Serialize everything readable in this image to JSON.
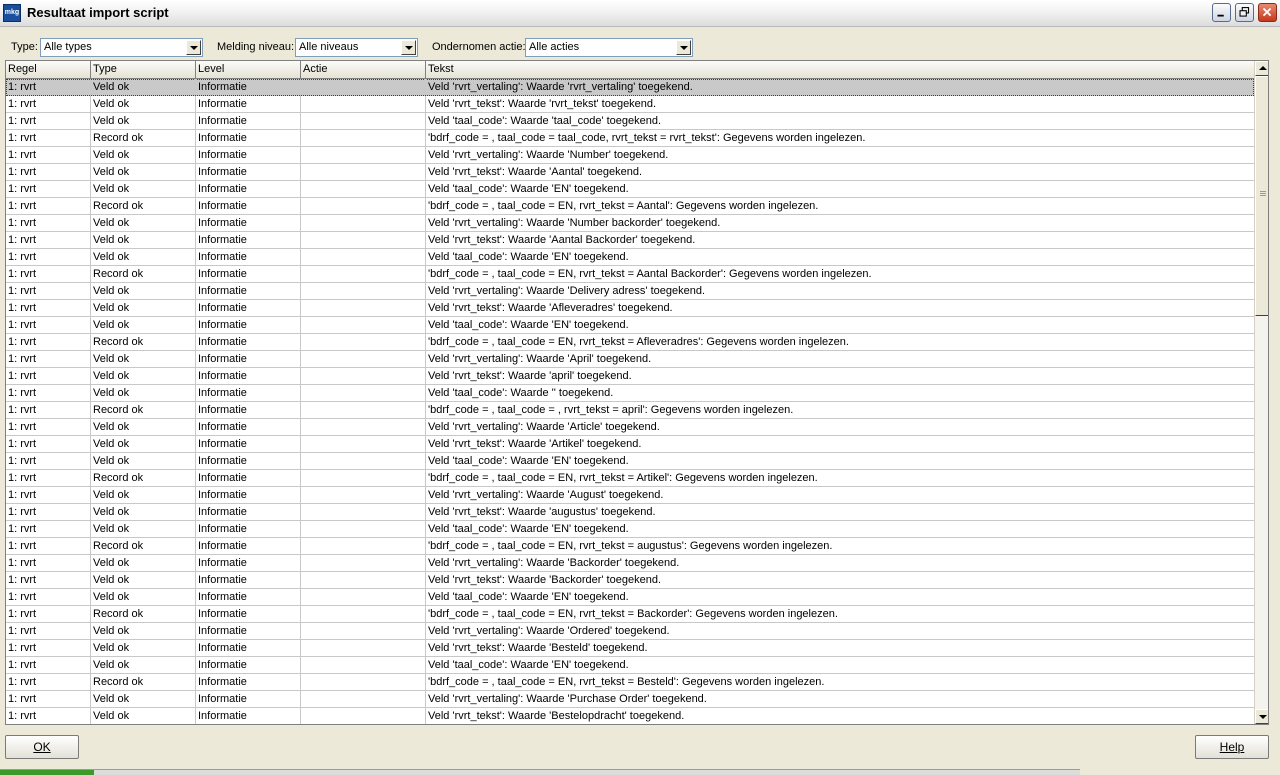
{
  "window": {
    "title": "Resultaat import script",
    "app_icon_text": "mkg"
  },
  "filters": {
    "type_label": "Type:",
    "type_value": "Alle types",
    "melding_label": "Melding niveau:",
    "melding_value": "Alle niveaus",
    "actie_label": "Ondernomen actie:",
    "actie_value": "Alle acties"
  },
  "grid": {
    "columns": [
      "Regel",
      "Type",
      "Level",
      "Actie",
      "Tekst"
    ],
    "rows": [
      {
        "regel": "1: rvrt",
        "type": "Veld ok",
        "level": "Informatie",
        "actie": "",
        "tekst": "Veld 'rvrt_vertaling': Waarde 'rvrt_vertaling' toegekend."
      },
      {
        "regel": "1: rvrt",
        "type": "Veld ok",
        "level": "Informatie",
        "actie": "",
        "tekst": "Veld 'rvrt_tekst': Waarde 'rvrt_tekst' toegekend."
      },
      {
        "regel": "1: rvrt",
        "type": "Veld ok",
        "level": "Informatie",
        "actie": "",
        "tekst": "Veld 'taal_code': Waarde 'taal_code' toegekend."
      },
      {
        "regel": "1: rvrt",
        "type": "Record ok",
        "level": "Informatie",
        "actie": "",
        "tekst": "'bdrf_code = , taal_code = taal_code, rvrt_tekst = rvrt_tekst': Gegevens worden ingelezen."
      },
      {
        "regel": "1: rvrt",
        "type": "Veld ok",
        "level": "Informatie",
        "actie": "",
        "tekst": "Veld 'rvrt_vertaling': Waarde 'Number' toegekend."
      },
      {
        "regel": "1: rvrt",
        "type": "Veld ok",
        "level": "Informatie",
        "actie": "",
        "tekst": "Veld 'rvrt_tekst': Waarde 'Aantal' toegekend."
      },
      {
        "regel": "1: rvrt",
        "type": "Veld ok",
        "level": "Informatie",
        "actie": "",
        "tekst": "Veld 'taal_code': Waarde 'EN' toegekend."
      },
      {
        "regel": "1: rvrt",
        "type": "Record ok",
        "level": "Informatie",
        "actie": "",
        "tekst": "'bdrf_code = , taal_code = EN, rvrt_tekst = Aantal': Gegevens worden ingelezen."
      },
      {
        "regel": "1: rvrt",
        "type": "Veld ok",
        "level": "Informatie",
        "actie": "",
        "tekst": "Veld 'rvrt_vertaling': Waarde 'Number backorder' toegekend."
      },
      {
        "regel": "1: rvrt",
        "type": "Veld ok",
        "level": "Informatie",
        "actie": "",
        "tekst": "Veld 'rvrt_tekst': Waarde 'Aantal Backorder' toegekend."
      },
      {
        "regel": "1: rvrt",
        "type": "Veld ok",
        "level": "Informatie",
        "actie": "",
        "tekst": "Veld 'taal_code': Waarde 'EN' toegekend."
      },
      {
        "regel": "1: rvrt",
        "type": "Record ok",
        "level": "Informatie",
        "actie": "",
        "tekst": "'bdrf_code = , taal_code = EN, rvrt_tekst = Aantal Backorder': Gegevens worden ingelezen."
      },
      {
        "regel": "1: rvrt",
        "type": "Veld ok",
        "level": "Informatie",
        "actie": "",
        "tekst": "Veld 'rvrt_vertaling': Waarde 'Delivery adress' toegekend."
      },
      {
        "regel": "1: rvrt",
        "type": "Veld ok",
        "level": "Informatie",
        "actie": "",
        "tekst": "Veld 'rvrt_tekst': Waarde 'Afleveradres' toegekend."
      },
      {
        "regel": "1: rvrt",
        "type": "Veld ok",
        "level": "Informatie",
        "actie": "",
        "tekst": "Veld 'taal_code': Waarde 'EN' toegekend."
      },
      {
        "regel": "1: rvrt",
        "type": "Record ok",
        "level": "Informatie",
        "actie": "",
        "tekst": "'bdrf_code = , taal_code = EN, rvrt_tekst = Afleveradres': Gegevens worden ingelezen."
      },
      {
        "regel": "1: rvrt",
        "type": "Veld ok",
        "level": "Informatie",
        "actie": "",
        "tekst": "Veld 'rvrt_vertaling': Waarde 'April' toegekend."
      },
      {
        "regel": "1: rvrt",
        "type": "Veld ok",
        "level": "Informatie",
        "actie": "",
        "tekst": "Veld 'rvrt_tekst': Waarde 'april' toegekend."
      },
      {
        "regel": "1: rvrt",
        "type": "Veld ok",
        "level": "Informatie",
        "actie": "",
        "tekst": "Veld 'taal_code': Waarde '' toegekend."
      },
      {
        "regel": "1: rvrt",
        "type": "Record ok",
        "level": "Informatie",
        "actie": "",
        "tekst": "'bdrf_code = , taal_code = , rvrt_tekst = april': Gegevens worden ingelezen."
      },
      {
        "regel": "1: rvrt",
        "type": "Veld ok",
        "level": "Informatie",
        "actie": "",
        "tekst": "Veld 'rvrt_vertaling': Waarde 'Article' toegekend."
      },
      {
        "regel": "1: rvrt",
        "type": "Veld ok",
        "level": "Informatie",
        "actie": "",
        "tekst": "Veld 'rvrt_tekst': Waarde 'Artikel' toegekend."
      },
      {
        "regel": "1: rvrt",
        "type": "Veld ok",
        "level": "Informatie",
        "actie": "",
        "tekst": "Veld 'taal_code': Waarde 'EN' toegekend."
      },
      {
        "regel": "1: rvrt",
        "type": "Record ok",
        "level": "Informatie",
        "actie": "",
        "tekst": "'bdrf_code = , taal_code = EN, rvrt_tekst = Artikel': Gegevens worden ingelezen."
      },
      {
        "regel": "1: rvrt",
        "type": "Veld ok",
        "level": "Informatie",
        "actie": "",
        "tekst": "Veld 'rvrt_vertaling': Waarde 'August' toegekend."
      },
      {
        "regel": "1: rvrt",
        "type": "Veld ok",
        "level": "Informatie",
        "actie": "",
        "tekst": "Veld 'rvrt_tekst': Waarde 'augustus' toegekend."
      },
      {
        "regel": "1: rvrt",
        "type": "Veld ok",
        "level": "Informatie",
        "actie": "",
        "tekst": "Veld 'taal_code': Waarde 'EN' toegekend."
      },
      {
        "regel": "1: rvrt",
        "type": "Record ok",
        "level": "Informatie",
        "actie": "",
        "tekst": "'bdrf_code = , taal_code = EN, rvrt_tekst = augustus': Gegevens worden ingelezen."
      },
      {
        "regel": "1: rvrt",
        "type": "Veld ok",
        "level": "Informatie",
        "actie": "",
        "tekst": "Veld 'rvrt_vertaling': Waarde 'Backorder' toegekend."
      },
      {
        "regel": "1: rvrt",
        "type": "Veld ok",
        "level": "Informatie",
        "actie": "",
        "tekst": "Veld 'rvrt_tekst': Waarde 'Backorder' toegekend."
      },
      {
        "regel": "1: rvrt",
        "type": "Veld ok",
        "level": "Informatie",
        "actie": "",
        "tekst": "Veld 'taal_code': Waarde 'EN' toegekend."
      },
      {
        "regel": "1: rvrt",
        "type": "Record ok",
        "level": "Informatie",
        "actie": "",
        "tekst": "'bdrf_code = , taal_code = EN, rvrt_tekst = Backorder': Gegevens worden ingelezen."
      },
      {
        "regel": "1: rvrt",
        "type": "Veld ok",
        "level": "Informatie",
        "actie": "",
        "tekst": "Veld 'rvrt_vertaling': Waarde 'Ordered' toegekend."
      },
      {
        "regel": "1: rvrt",
        "type": "Veld ok",
        "level": "Informatie",
        "actie": "",
        "tekst": "Veld 'rvrt_tekst': Waarde 'Besteld' toegekend."
      },
      {
        "regel": "1: rvrt",
        "type": "Veld ok",
        "level": "Informatie",
        "actie": "",
        "tekst": "Veld 'taal_code': Waarde 'EN' toegekend."
      },
      {
        "regel": "1: rvrt",
        "type": "Record ok",
        "level": "Informatie",
        "actie": "",
        "tekst": "'bdrf_code = , taal_code = EN, rvrt_tekst = Besteld': Gegevens worden ingelezen."
      },
      {
        "regel": "1: rvrt",
        "type": "Veld ok",
        "level": "Informatie",
        "actie": "",
        "tekst": "Veld 'rvrt_vertaling': Waarde 'Purchase Order' toegekend."
      },
      {
        "regel": "1: rvrt",
        "type": "Veld ok",
        "level": "Informatie",
        "actie": "",
        "tekst": "Veld 'rvrt_tekst': Waarde 'Bestelopdracht' toegekend."
      }
    ]
  },
  "footer": {
    "ok_label": "OK",
    "help_label": "Help"
  }
}
